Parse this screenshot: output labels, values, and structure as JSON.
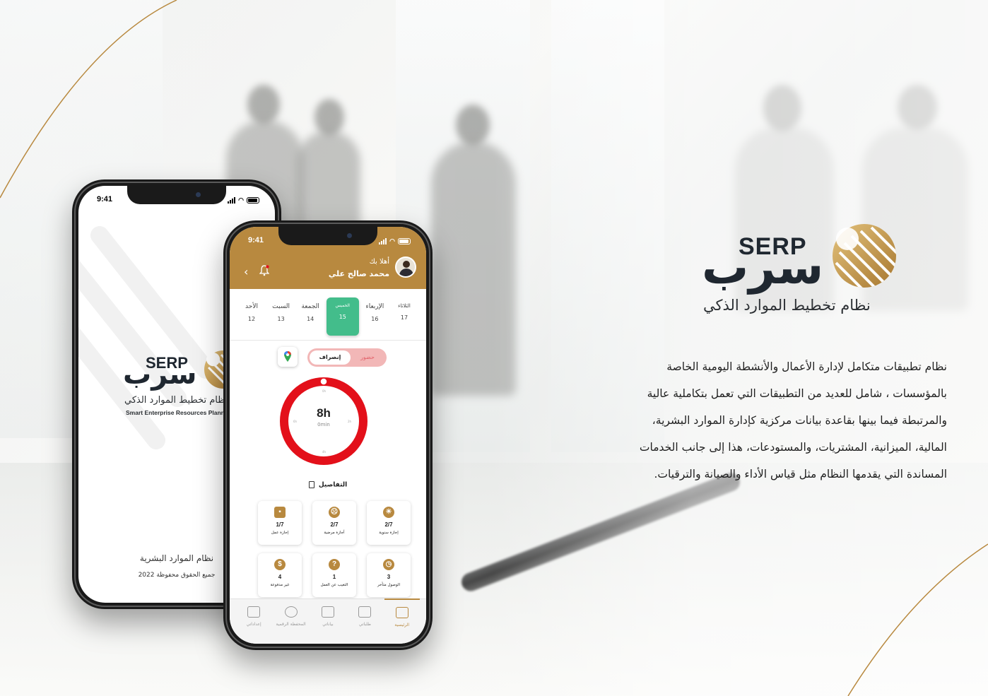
{
  "brand": {
    "name_en": "SERP",
    "name_ar": "سرب",
    "tagline_ar": "نظام تخطيط الموارد الذكي",
    "accent_color": "#b8893f",
    "dark_color": "#1f2730"
  },
  "description": [
    "نظام تطبيقات متكامل لإدارة الأعمال والأنشطة اليومية الخاصة",
    "بالمؤسسات ، شامل للعديد من التطبيقات التي تعمل بتكاملية عالية",
    "والمرتبطة فيما بينها بقاعدة بيانات مركزية كإدارة الموارد البشرية،",
    "المالية، الميزانية، المشتريات، والمستودعات، هذا إلى جانب الخدمات",
    "المساندة التي يقدمها النظام مثل قياس الأداء والصيانة والترقيات."
  ],
  "splash": {
    "status_time": "9:41",
    "logo_en": "SERP",
    "logo_ar": "سرب",
    "tagline_ar": "نظام تخطيط الموارد الذكي",
    "tagline_en": "Smart Enterprise Resources Plann",
    "footer_title": "نظام الموارد البشرية",
    "footer_copyright": "جميع الحقوق محفوظة 2022"
  },
  "app": {
    "status_time": "9:41",
    "greeting": "أهلا بك",
    "user_name": "محمد صالح علي",
    "days": [
      {
        "name": "الثلاثاء",
        "date": "17"
      },
      {
        "name": "الإربعاء",
        "date": "16"
      },
      {
        "name": "الخميس",
        "date": "15",
        "active": true
      },
      {
        "name": "الجمعة",
        "date": "14"
      },
      {
        "name": "السبت",
        "date": "13"
      },
      {
        "name": "الأحد",
        "date": "12"
      }
    ],
    "toggle": {
      "selected": "إنصراف",
      "other": "حضور"
    },
    "timer": {
      "hours": "8h",
      "minutes": "0min",
      "progress": 1.0,
      "ring_color": "#e3101a"
    },
    "details_label": "التفاصيل",
    "cards": [
      {
        "icon": "weather-icon",
        "value": "2/7",
        "label": "إجازة سنوية"
      },
      {
        "icon": "sick-icon",
        "value": "2/7",
        "label": "أجازة مرضية"
      },
      {
        "icon": "work-leave-icon",
        "value": "1/7",
        "label": "إجازة عمل"
      },
      {
        "icon": "late-icon",
        "value": "3",
        "label": "الوصول متأخر"
      },
      {
        "icon": "absence-icon",
        "value": "1",
        "label": "التغيب عن العمل"
      },
      {
        "icon": "dollar-icon",
        "value": "4",
        "label": "غير مدفوعة"
      }
    ],
    "tabs": [
      {
        "label": "الرئيسية",
        "icon": "home-icon",
        "active": true
      },
      {
        "label": "طلباتي",
        "icon": "layers-icon"
      },
      {
        "label": "بياناتي",
        "icon": "documents-icon"
      },
      {
        "label": "المحفظة الرقمية",
        "icon": "wallet-icon"
      },
      {
        "label": "إعداداتي",
        "icon": "settings-icon"
      }
    ]
  }
}
